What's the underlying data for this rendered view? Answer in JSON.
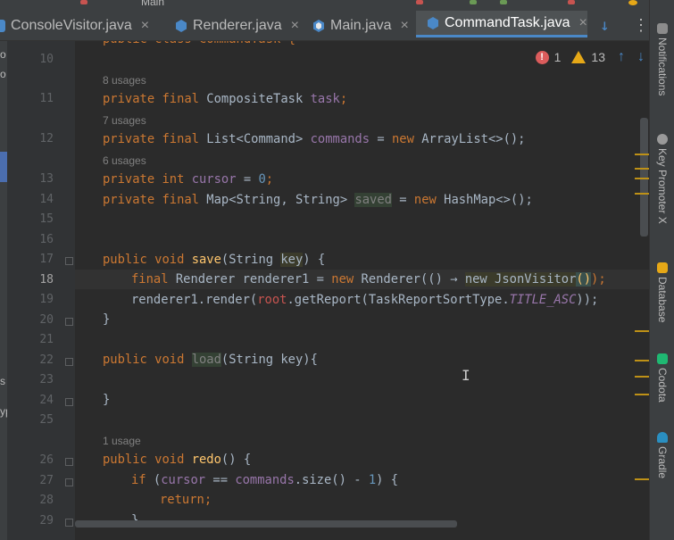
{
  "top_strip_fragment": "Main",
  "tabs": [
    {
      "label": "ConsoleVisitor.java",
      "close": "×"
    },
    {
      "label": "Renderer.java",
      "close": "×"
    },
    {
      "label": "Main.java",
      "close": "×"
    },
    {
      "label": "CommandTask.java",
      "close": "×",
      "active": true
    }
  ],
  "tab_tools": {
    "arrow": "↓",
    "more": "⋮"
  },
  "left_fragments": [
    "o",
    "o",
    "s",
    "yp"
  ],
  "inspection": {
    "errors": "1",
    "warnings": "13",
    "up": "↑",
    "down": "↓"
  },
  "line_numbers": [
    "10",
    "11",
    "12",
    "13",
    "14",
    "15",
    "16",
    "17",
    "18",
    "19",
    "20",
    "21",
    "22",
    "23",
    "24",
    "25",
    "26",
    "27",
    "28",
    "29"
  ],
  "current_line": "18",
  "hints": [
    "8 usages",
    "7 usages",
    "6 usages",
    "1 usage"
  ],
  "code": {
    "l10": "public class CommandTask {",
    "l11_kw": "private final ",
    "l11_type": "CompositeTask ",
    "l11_fld": "task",
    "l11_end": ";",
    "l12_kw": "private final ",
    "l12_type": "List<Command> ",
    "l12_fld": "commands",
    "l12_mid": " = ",
    "l12_new": "new ",
    "l12_end": "ArrayList<>();",
    "l13_kw": "private int ",
    "l13_fld": "cursor",
    "l13_mid": " = ",
    "l13_num": "0",
    "l13_end": ";",
    "l14_kw": "private final ",
    "l14_type": "Map<String, String> ",
    "l14_fld": "saved",
    "l14_mid": " = ",
    "l14_new": "new ",
    "l14_end": "HashMap<>();",
    "l17_kw": "public void ",
    "l17_fn": "save",
    "l17_mid": "(String ",
    "l17_param": "key",
    "l17_end": ") {",
    "l18_kw": "final ",
    "l18_a": "Renderer renderer1 = ",
    "l18_new": "new ",
    "l18_b": "Renderer(() → ",
    "l18_new2": "new ",
    "l18_c": "JsonVisitor",
    "l18_paren": "()",
    "l18_end": ");",
    "l19_a": "renderer1.render(",
    "l19_red": "root",
    "l19_b": ".getReport(TaskReportSortType.",
    "l19_it": "TITLE_ASC",
    "l19_end": "));",
    "l20": "}",
    "l22_kw": "public void ",
    "l22_fn": "load",
    "l22_end": "(String key){",
    "l24": "}",
    "l26_kw": "public void ",
    "l26_fn": "redo",
    "l26_end": "() {",
    "l27_kw": "if ",
    "l27_a": "(",
    "l27_fld": "cursor",
    "l27_b": " == ",
    "l27_fld2": "commands",
    "l27_c": ".size() - ",
    "l27_num": "1",
    "l27_end": ") {",
    "l28_kw": "return",
    "l28_end": ";",
    "l29": "}"
  },
  "right_tools": [
    "Notifications",
    "Key Promoter X",
    "Database",
    "Codota",
    "Gradle"
  ],
  "colors": {
    "accent": "#4a88c7",
    "error": "#db5c5c",
    "warning": "#e6a817",
    "keyword": "#cc7832",
    "field": "#9876aa",
    "function": "#ffc66d"
  }
}
